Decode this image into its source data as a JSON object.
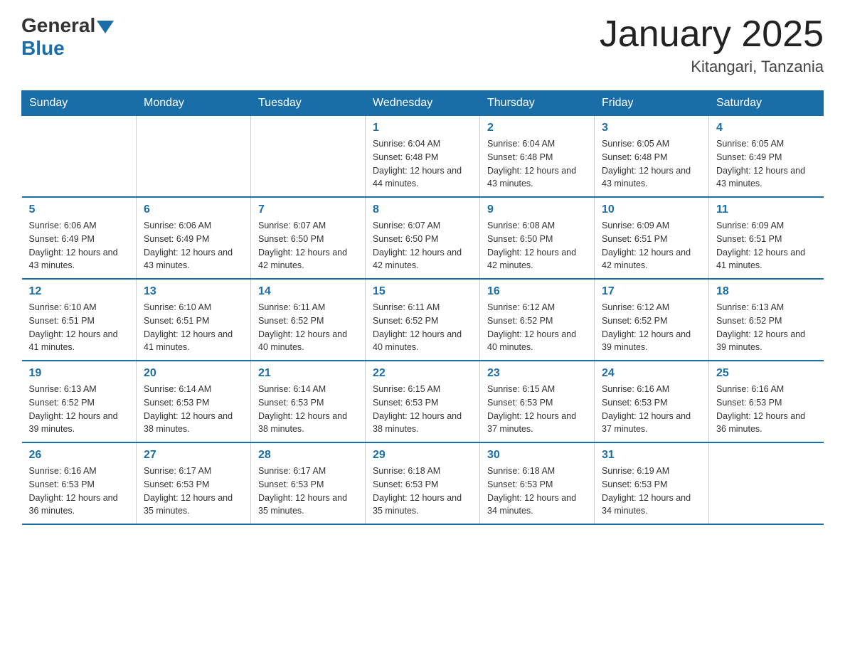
{
  "header": {
    "logo_general": "General",
    "logo_blue": "Blue",
    "title": "January 2025",
    "location": "Kitangari, Tanzania"
  },
  "days_of_week": [
    "Sunday",
    "Monday",
    "Tuesday",
    "Wednesday",
    "Thursday",
    "Friday",
    "Saturday"
  ],
  "weeks": [
    [
      {
        "day": "",
        "info": ""
      },
      {
        "day": "",
        "info": ""
      },
      {
        "day": "",
        "info": ""
      },
      {
        "day": "1",
        "info": "Sunrise: 6:04 AM\nSunset: 6:48 PM\nDaylight: 12 hours and 44 minutes."
      },
      {
        "day": "2",
        "info": "Sunrise: 6:04 AM\nSunset: 6:48 PM\nDaylight: 12 hours and 43 minutes."
      },
      {
        "day": "3",
        "info": "Sunrise: 6:05 AM\nSunset: 6:48 PM\nDaylight: 12 hours and 43 minutes."
      },
      {
        "day": "4",
        "info": "Sunrise: 6:05 AM\nSunset: 6:49 PM\nDaylight: 12 hours and 43 minutes."
      }
    ],
    [
      {
        "day": "5",
        "info": "Sunrise: 6:06 AM\nSunset: 6:49 PM\nDaylight: 12 hours and 43 minutes."
      },
      {
        "day": "6",
        "info": "Sunrise: 6:06 AM\nSunset: 6:49 PM\nDaylight: 12 hours and 43 minutes."
      },
      {
        "day": "7",
        "info": "Sunrise: 6:07 AM\nSunset: 6:50 PM\nDaylight: 12 hours and 42 minutes."
      },
      {
        "day": "8",
        "info": "Sunrise: 6:07 AM\nSunset: 6:50 PM\nDaylight: 12 hours and 42 minutes."
      },
      {
        "day": "9",
        "info": "Sunrise: 6:08 AM\nSunset: 6:50 PM\nDaylight: 12 hours and 42 minutes."
      },
      {
        "day": "10",
        "info": "Sunrise: 6:09 AM\nSunset: 6:51 PM\nDaylight: 12 hours and 42 minutes."
      },
      {
        "day": "11",
        "info": "Sunrise: 6:09 AM\nSunset: 6:51 PM\nDaylight: 12 hours and 41 minutes."
      }
    ],
    [
      {
        "day": "12",
        "info": "Sunrise: 6:10 AM\nSunset: 6:51 PM\nDaylight: 12 hours and 41 minutes."
      },
      {
        "day": "13",
        "info": "Sunrise: 6:10 AM\nSunset: 6:51 PM\nDaylight: 12 hours and 41 minutes."
      },
      {
        "day": "14",
        "info": "Sunrise: 6:11 AM\nSunset: 6:52 PM\nDaylight: 12 hours and 40 minutes."
      },
      {
        "day": "15",
        "info": "Sunrise: 6:11 AM\nSunset: 6:52 PM\nDaylight: 12 hours and 40 minutes."
      },
      {
        "day": "16",
        "info": "Sunrise: 6:12 AM\nSunset: 6:52 PM\nDaylight: 12 hours and 40 minutes."
      },
      {
        "day": "17",
        "info": "Sunrise: 6:12 AM\nSunset: 6:52 PM\nDaylight: 12 hours and 39 minutes."
      },
      {
        "day": "18",
        "info": "Sunrise: 6:13 AM\nSunset: 6:52 PM\nDaylight: 12 hours and 39 minutes."
      }
    ],
    [
      {
        "day": "19",
        "info": "Sunrise: 6:13 AM\nSunset: 6:52 PM\nDaylight: 12 hours and 39 minutes."
      },
      {
        "day": "20",
        "info": "Sunrise: 6:14 AM\nSunset: 6:53 PM\nDaylight: 12 hours and 38 minutes."
      },
      {
        "day": "21",
        "info": "Sunrise: 6:14 AM\nSunset: 6:53 PM\nDaylight: 12 hours and 38 minutes."
      },
      {
        "day": "22",
        "info": "Sunrise: 6:15 AM\nSunset: 6:53 PM\nDaylight: 12 hours and 38 minutes."
      },
      {
        "day": "23",
        "info": "Sunrise: 6:15 AM\nSunset: 6:53 PM\nDaylight: 12 hours and 37 minutes."
      },
      {
        "day": "24",
        "info": "Sunrise: 6:16 AM\nSunset: 6:53 PM\nDaylight: 12 hours and 37 minutes."
      },
      {
        "day": "25",
        "info": "Sunrise: 6:16 AM\nSunset: 6:53 PM\nDaylight: 12 hours and 36 minutes."
      }
    ],
    [
      {
        "day": "26",
        "info": "Sunrise: 6:16 AM\nSunset: 6:53 PM\nDaylight: 12 hours and 36 minutes."
      },
      {
        "day": "27",
        "info": "Sunrise: 6:17 AM\nSunset: 6:53 PM\nDaylight: 12 hours and 35 minutes."
      },
      {
        "day": "28",
        "info": "Sunrise: 6:17 AM\nSunset: 6:53 PM\nDaylight: 12 hours and 35 minutes."
      },
      {
        "day": "29",
        "info": "Sunrise: 6:18 AM\nSunset: 6:53 PM\nDaylight: 12 hours and 35 minutes."
      },
      {
        "day": "30",
        "info": "Sunrise: 6:18 AM\nSunset: 6:53 PM\nDaylight: 12 hours and 34 minutes."
      },
      {
        "day": "31",
        "info": "Sunrise: 6:19 AM\nSunset: 6:53 PM\nDaylight: 12 hours and 34 minutes."
      },
      {
        "day": "",
        "info": ""
      }
    ]
  ]
}
